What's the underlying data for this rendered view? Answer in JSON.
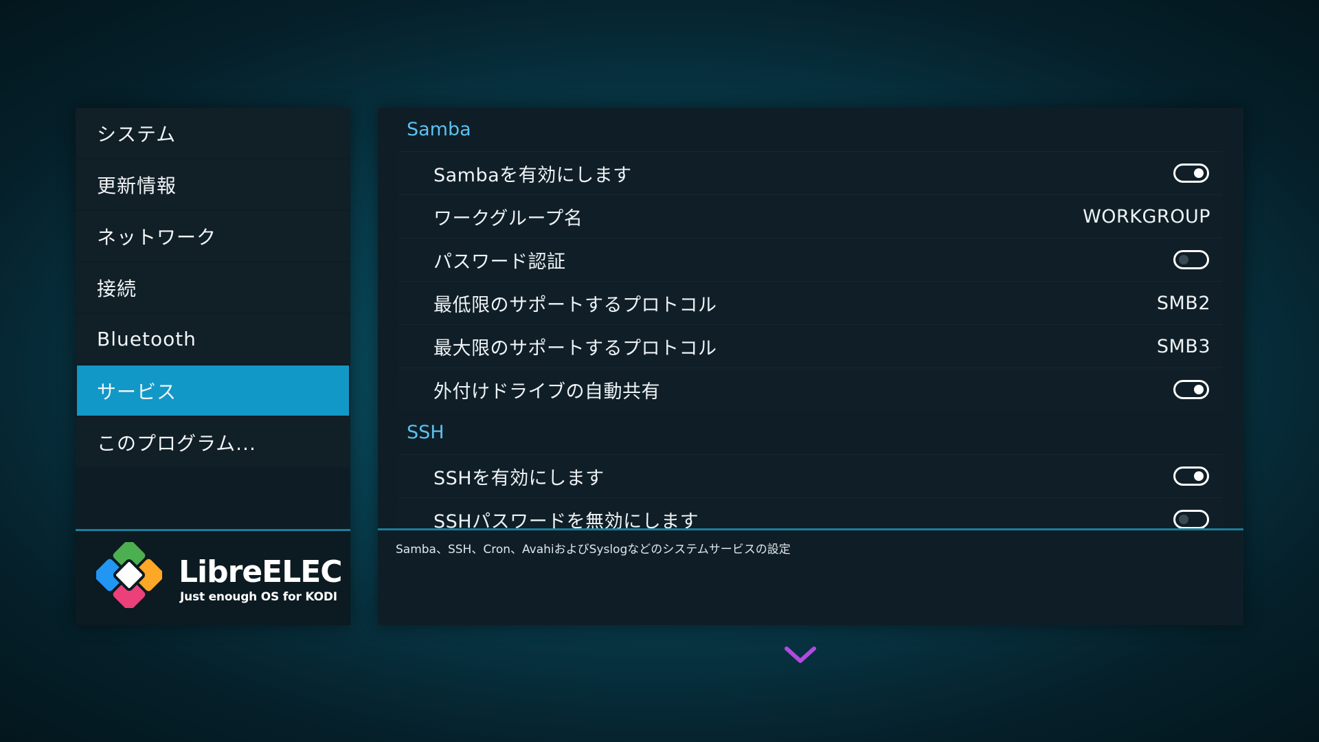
{
  "sidebar": {
    "items": [
      {
        "label": "システム"
      },
      {
        "label": "更新情報"
      },
      {
        "label": "ネットワーク"
      },
      {
        "label": "接続"
      },
      {
        "label": "Bluetooth"
      },
      {
        "label": "サービス",
        "active": true
      },
      {
        "label": "このプログラム..."
      }
    ]
  },
  "logo": {
    "title": "LibreELEC",
    "tagline": "Just enough OS for KODI",
    "colors": [
      "#4caf50",
      "#ffa726",
      "#2196f3",
      "#ec407a"
    ]
  },
  "settings": {
    "samba": {
      "header": "Samba",
      "rows": [
        {
          "label": "Sambaを有効にします",
          "toggle": "on"
        },
        {
          "label": "ワークグループ名",
          "value": "WORKGROUP"
        },
        {
          "label": "パスワード認証",
          "toggle": "off"
        },
        {
          "label": "最低限のサポートするプロトコル",
          "value": "SMB2"
        },
        {
          "label": "最大限のサポートするプロトコル",
          "value": "SMB3"
        },
        {
          "label": "外付けドライブの自動共有",
          "toggle": "on"
        }
      ]
    },
    "ssh": {
      "header": "SSH",
      "rows": [
        {
          "label": "SSHを有効にします",
          "toggle": "on"
        },
        {
          "label": "SSHパスワードを無効にします",
          "toggle": "off"
        }
      ]
    }
  },
  "description": "Samba、SSH、Cron、AvahiおよびSyslogなどのシステムサービスの設定",
  "colors": {
    "accent": "#1298c7",
    "section_header": "#5cc1ef",
    "scroll_arrow": "#b04ae0"
  },
  "icons": {
    "scroll_down": "chevron-down-icon"
  }
}
